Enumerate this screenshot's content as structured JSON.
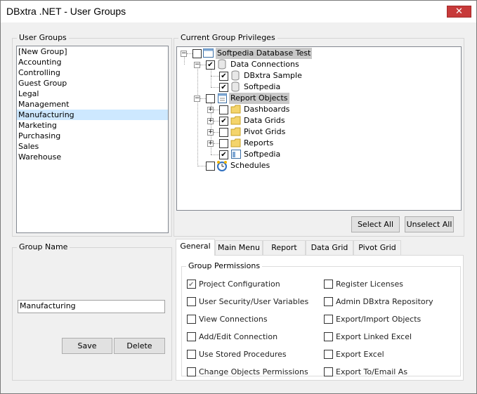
{
  "window": {
    "title": "DBxtra .NET - User Groups",
    "close_glyph": "✕"
  },
  "user_groups": {
    "title": "User Groups",
    "selected_index": 6,
    "items": [
      "[New Group]",
      "Accounting",
      "Controlling",
      "Guest Group",
      "Legal",
      "Management",
      "Manufacturing",
      "Marketing",
      "Purchasing",
      "Sales",
      "Warehouse"
    ]
  },
  "group_name": {
    "title": "Group Name",
    "value": "Manufacturing",
    "save_label": "Save",
    "delete_label": "Delete"
  },
  "privileges": {
    "title": "Current Group Privileges",
    "tree": {
      "root": {
        "label": "Softpedia Database Test",
        "checked": false,
        "icon": "form-icon",
        "expander": "−"
      },
      "data_connections": {
        "label": "Data Connections",
        "checked": true,
        "icon": "database-icon",
        "expander": "−"
      },
      "dbxtra_sample": {
        "label": "DBxtra Sample",
        "checked": true,
        "icon": "database-icon"
      },
      "softpedia_conn": {
        "label": "Softpedia",
        "checked": true,
        "icon": "database-icon"
      },
      "report_objects": {
        "label": "Report Objects",
        "checked": false,
        "icon": "report-icon",
        "expander": "−"
      },
      "dashboards": {
        "label": "Dashboards",
        "checked": false,
        "icon": "folder-icon",
        "expander": "+"
      },
      "data_grids": {
        "label": "Data Grids",
        "checked": true,
        "icon": "folder-icon",
        "expander": "+"
      },
      "pivot_grids": {
        "label": "Pivot Grids",
        "checked": false,
        "icon": "folder-icon",
        "expander": "+"
      },
      "reports": {
        "label": "Reports",
        "checked": false,
        "icon": "folder-icon",
        "expander": "+"
      },
      "softpedia_obj": {
        "label": "Softpedia",
        "checked": true,
        "icon": "dashboard-icon"
      },
      "schedules": {
        "label": "Schedules",
        "checked": false,
        "icon": "alarm-clock-icon"
      }
    },
    "select_all_label": "Select All",
    "unselect_all_label": "Unselect All"
  },
  "tabs": {
    "items": [
      "General",
      "Main Menu",
      "Report",
      "Data Grid",
      "Pivot Grid"
    ],
    "active_index": 0
  },
  "permissions": {
    "title": "Group Permissions",
    "left": [
      {
        "label": "Project Configuration",
        "checked": true
      },
      {
        "label": "User Security/User Variables",
        "checked": false
      },
      {
        "label": "View Connections",
        "checked": false
      },
      {
        "label": "Add/Edit Connection",
        "checked": false
      },
      {
        "label": "Use Stored Procedures",
        "checked": false
      },
      {
        "label": "Change Objects Permissions",
        "checked": false
      }
    ],
    "right": [
      {
        "label": "Register Licenses",
        "checked": false
      },
      {
        "label": "Admin DBxtra Repository",
        "checked": false
      },
      {
        "label": "Export/Import Objects",
        "checked": false
      },
      {
        "label": "Export Linked Excel",
        "checked": false
      },
      {
        "label": "Export Excel",
        "checked": false
      },
      {
        "label": "Export To/Email As",
        "checked": false
      }
    ]
  }
}
